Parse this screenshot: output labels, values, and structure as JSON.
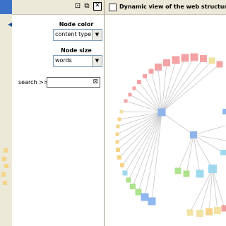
{
  "control_panel": {
    "node_color": {
      "label": "Node color",
      "value": "content type"
    },
    "node_size": {
      "label": "Node size",
      "value": "words"
    },
    "search": {
      "label": "search >>",
      "value": ""
    },
    "titlebar_icons": [
      "restore-icon",
      "maximize-icon",
      "close-icon"
    ]
  },
  "graph_view": {
    "title": "Dynamic view of the web structure"
  },
  "colors": {
    "pink": "#f4a3a5",
    "salmon": "#f0a09e",
    "yellow": "#f5d48a",
    "light_yellow": "#f2e3a3",
    "green": "#aee28d",
    "blue": "#8fb7f0",
    "cyan": "#9fd9ee",
    "hub_blue": "#8fb4ec"
  }
}
